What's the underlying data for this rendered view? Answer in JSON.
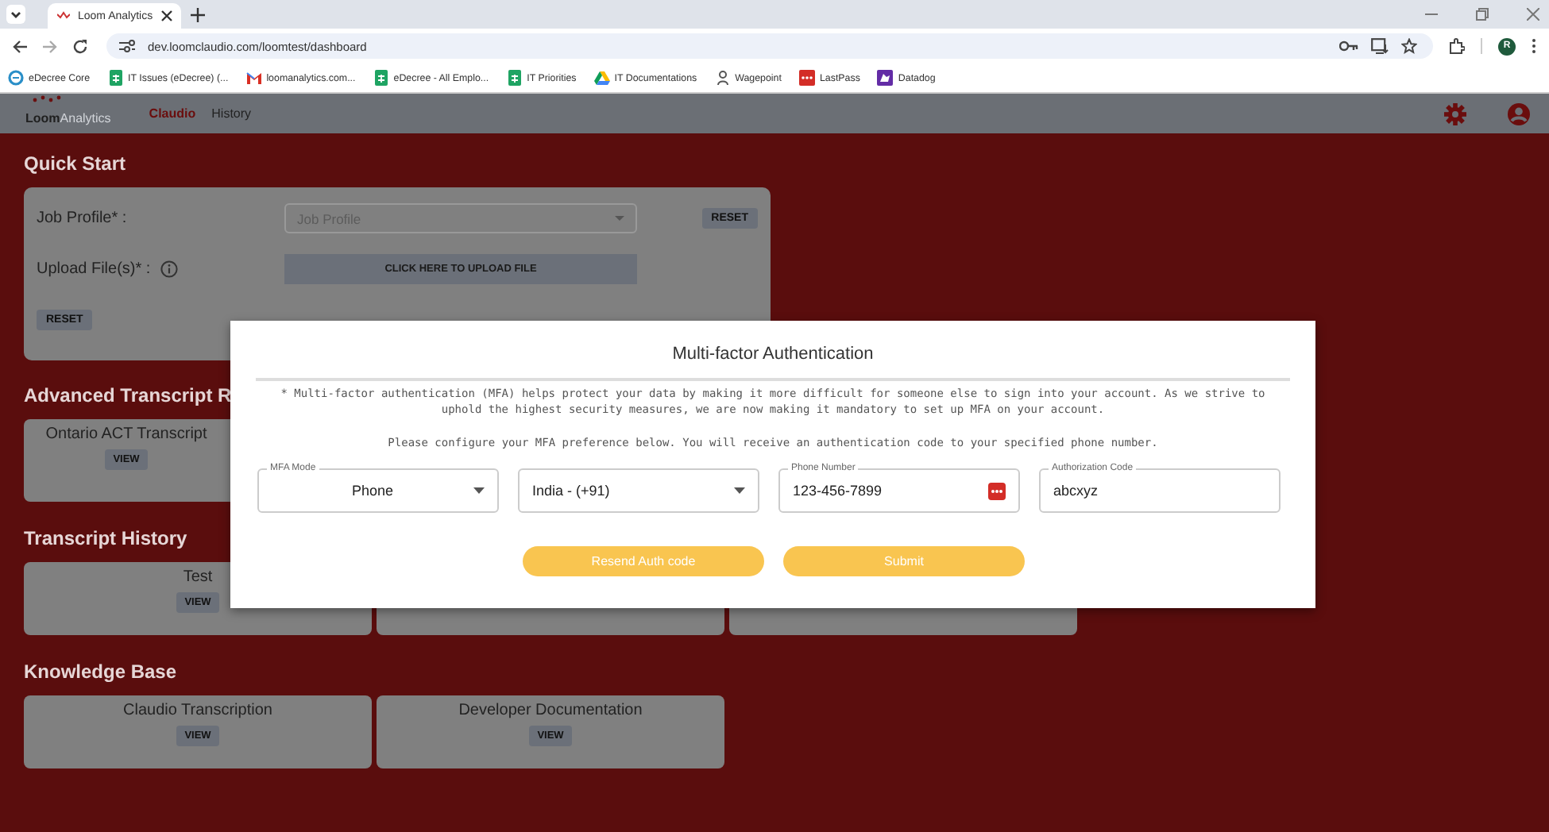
{
  "browser": {
    "tab": {
      "title": "Loom Analytics"
    },
    "url": "dev.loomclaudio.com/loomtest/dashboard",
    "profile_initial": "R",
    "bookmarks": [
      {
        "kind": "edecree",
        "label": "eDecree Core"
      },
      {
        "kind": "sheet",
        "label": "IT Issues (eDecree) (..."
      },
      {
        "kind": "mail",
        "label": "loomanalytics.com..."
      },
      {
        "kind": "sheet",
        "label": "eDecree - All Emplo..."
      },
      {
        "kind": "sheet",
        "label": "IT Priorities"
      },
      {
        "kind": "drive",
        "label": "IT Documentations"
      },
      {
        "kind": "wage",
        "label": "Wagepoint"
      },
      {
        "kind": "lastpass",
        "label": "LastPass"
      },
      {
        "kind": "datadog",
        "label": "Datadog"
      }
    ]
  },
  "app": {
    "logo": {
      "bold": "Loom",
      "light": "Analytics"
    },
    "nav": [
      {
        "label": "Claudio",
        "selected": true
      },
      {
        "label": "History",
        "selected": false
      }
    ]
  },
  "quick_start": {
    "title": "Quick Start",
    "job_profile": {
      "label": "Job Profile* :",
      "placeholder": "Job Profile",
      "reset": "RESET"
    },
    "upload": {
      "label": "Upload File(s)* :",
      "button": "CLICK HERE TO UPLOAD FILE"
    },
    "reset": "RESET"
  },
  "sections": [
    {
      "title": "Advanced Transcript R",
      "cards": [
        {
          "title": "Ontario ACT Transcript",
          "button": "VIEW"
        }
      ]
    },
    {
      "title": "Transcript History",
      "cards": [
        {
          "title": "Test",
          "button": "VIEW"
        },
        {
          "kind": "covered"
        },
        {
          "kind": "covered"
        }
      ]
    },
    {
      "title": "Knowledge Base",
      "cards": [
        {
          "title": "Claudio Transcription",
          "button": "VIEW"
        },
        {
          "title": "Developer Documentation",
          "button": "VIEW"
        }
      ]
    }
  ],
  "modal": {
    "title": "Multi-factor Authentication",
    "notes": [
      "* Multi-factor authentication (MFA) helps protect your data by making it more difficult for someone else to sign into your account. As we strive to uphold the highest security measures, we are now making it mandatory to set up MFA on your account.",
      "Please configure your MFA preference below. You will receive an authentication code to your specified phone number."
    ],
    "fields": [
      {
        "kind": "mode",
        "label": "MFA Mode",
        "value": "Phone"
      },
      {
        "kind": "select",
        "value": "India - (+91)"
      },
      {
        "kind": "phone",
        "label": "Phone Number",
        "value": "123-456-7899"
      },
      {
        "kind": "text",
        "label": "Authorization Code",
        "value": "abcxyz"
      }
    ],
    "buttons": [
      "Resend Auth code",
      "Submit"
    ]
  }
}
